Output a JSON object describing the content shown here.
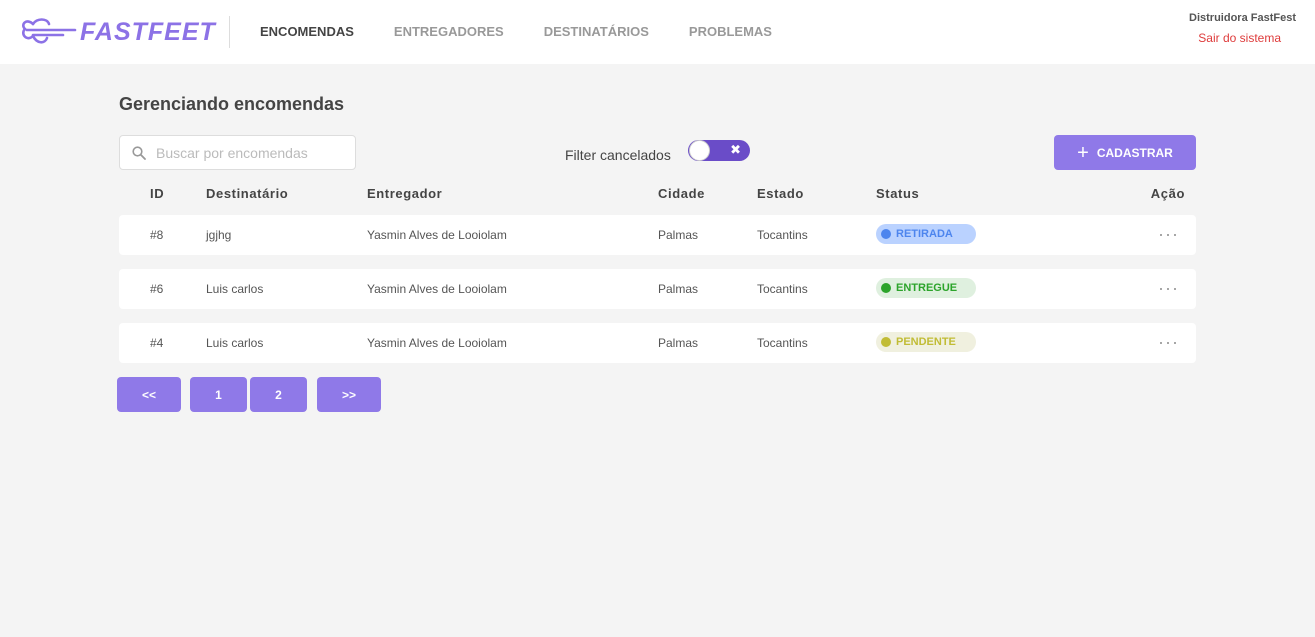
{
  "brand": {
    "logo_text": "FASTFEET",
    "accent": "#7d40e7"
  },
  "nav": {
    "items": [
      {
        "label": "ENCOMENDAS",
        "active": true
      },
      {
        "label": "ENTREGADORES",
        "active": false
      },
      {
        "label": "DESTINATÁRIOS",
        "active": false
      },
      {
        "label": "PROBLEMAS",
        "active": false
      }
    ]
  },
  "profile": {
    "name": "Distruidora FastFest",
    "logout_label": "Sair do sistema"
  },
  "page": {
    "title": "Gerenciando encomendas",
    "search_placeholder": "Buscar por encomendas",
    "filter_label": "Filter cancelados",
    "filter_icon": "close-icon",
    "add_label": "CADASTRAR"
  },
  "table": {
    "columns": [
      "ID",
      "Destinatário",
      "Entregador",
      "Cidade",
      "Estado",
      "Status",
      "Ação"
    ],
    "rows": [
      {
        "id": "#8",
        "recipient": "jgjhg",
        "deliveryman": "Yasmin Alves de Looiolam",
        "city": "Palmas",
        "state": "Tocantins",
        "status": "RETIRADA",
        "status_bg": "#bad2ff",
        "status_color": "#4d85ee"
      },
      {
        "id": "#6",
        "recipient": "Luis carlos",
        "deliveryman": "Yasmin Alves de Looiolam",
        "city": "Palmas",
        "state": "Tocantins",
        "status": "ENTREGUE",
        "status_bg": "#dff0df",
        "status_color": "#2ca42b"
      },
      {
        "id": "#4",
        "recipient": "Luis carlos",
        "deliveryman": "Yasmin Alves de Looiolam",
        "city": "Palmas",
        "state": "Tocantins",
        "status": "PENDENTE",
        "status_bg": "#f0f0df",
        "status_color": "#c1bc35"
      }
    ],
    "action_label": "···"
  },
  "pagination": {
    "prev": "<<",
    "pages": [
      "1",
      "2"
    ],
    "next": ">>"
  }
}
